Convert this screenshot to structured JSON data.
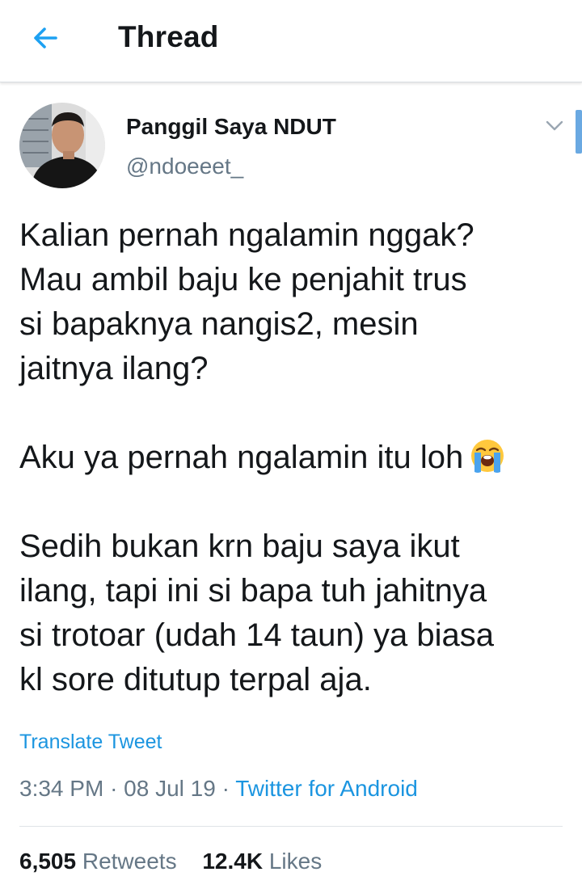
{
  "header": {
    "title": "Thread",
    "back_icon": "arrow-left-icon",
    "accent_color": "#1da1f2"
  },
  "tweet": {
    "author": {
      "name": "Panggil Saya NDUT",
      "handle": "@ndoeeet_",
      "avatar_icon": "avatar-photo"
    },
    "menu_icon": "chevron-down-icon",
    "text": {
      "p1": [
        "Kalian pernah ngalamin nggak?",
        "Mau ambil baju ke penjahit trus",
        "si bapaknya nangis2, mesin",
        "jaitnya ilang?"
      ],
      "p2": "Aku ya pernah ngalamin itu loh",
      "p2_emoji": "loudly-crying-face-icon",
      "p3": [
        "Sedih bukan krn baju saya ikut",
        "ilang, tapi ini si bapa tuh jahitnya",
        "si trotoar (udah 14 taun) ya biasa",
        "kl sore ditutup terpal aja."
      ]
    },
    "translate_label": "Translate Tweet",
    "time": "3:34 PM",
    "separator": "·",
    "date": "08 Jul 19",
    "source": "Twitter for Android",
    "stats": {
      "retweets_count": "6,505",
      "retweets_label": "Retweets",
      "likes_count": "12.4K",
      "likes_label": "Likes"
    }
  }
}
